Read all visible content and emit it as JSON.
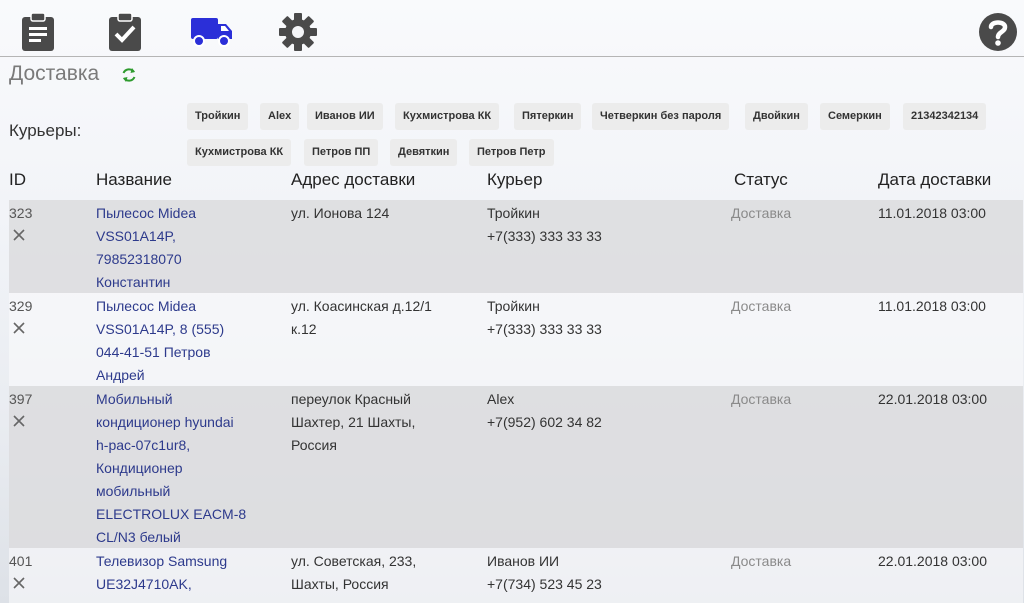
{
  "nav": {
    "icons": [
      "clipboard-list-icon",
      "clipboard-check-icon",
      "truck-icon",
      "gear-icon",
      "help-icon"
    ],
    "active": "truck-icon",
    "active_color": "#2b2fd8"
  },
  "page": {
    "title": "Доставка"
  },
  "couriers": {
    "label": "Курьеры:",
    "items": [
      "Тройкин",
      "Alex",
      "Иванов ИИ",
      "Кухмистрова КК",
      "Пятеркин",
      "Четверкин без пароля",
      "Двойкин",
      "Семеркин",
      "21342342134",
      "Кухмистрова КК",
      "Петров ПП",
      "Девяткин",
      "Петров Петр"
    ]
  },
  "table": {
    "headers": {
      "id": "ID",
      "name": "Название",
      "address": "Адрес доставки",
      "courier": "Курьер",
      "status": "Статус",
      "date": "Дата доставки"
    },
    "rows": [
      {
        "id": "323",
        "name_lines": [
          "Пылесос Midea",
          "VSS01A14P,",
          "79852318070",
          "Константин"
        ],
        "address_lines": [
          "ул. Ионова 124"
        ],
        "courier_name": "Тройкин",
        "courier_phone": "+7(333) 333 33 33",
        "status": "Доставка",
        "date": "11.01.2018 03:00"
      },
      {
        "id": "329",
        "name_lines": [
          "Пылесос Midea",
          "VSS01A14P, 8 (555)",
          "044-41-51 Петров",
          "Андрей"
        ],
        "address_lines": [
          "ул. Коасинская д.12/1",
          "к.12"
        ],
        "courier_name": "Тройкин",
        "courier_phone": "+7(333) 333 33 33",
        "status": "Доставка",
        "date": "11.01.2018 03:00"
      },
      {
        "id": "397",
        "name_lines": [
          "Мобильный",
          "кондиционер hyundai",
          "h-pac-07c1ur8,",
          "Кондиционер",
          "мобильный",
          "ELECTROLUX EACM-8",
          "CL/N3 белый"
        ],
        "address_lines": [
          "переулок Красный",
          "Шахтер, 21 Шахты,",
          "Россия"
        ],
        "courier_name": "Alex",
        "courier_phone": "+7(952) 602 34 82",
        "status": "Доставка",
        "date": "22.01.2018 03:00"
      },
      {
        "id": "401",
        "name_lines": [
          "Телевизор Samsung",
          "UE32J4710AK,"
        ],
        "address_lines": [
          "ул. Советская, 233,",
          "Шахты, Россия"
        ],
        "courier_name": "Иванов ИИ",
        "courier_phone": "+7(734) 523 45 23",
        "status": "Доставка",
        "date": "22.01.2018 03:00"
      }
    ]
  }
}
